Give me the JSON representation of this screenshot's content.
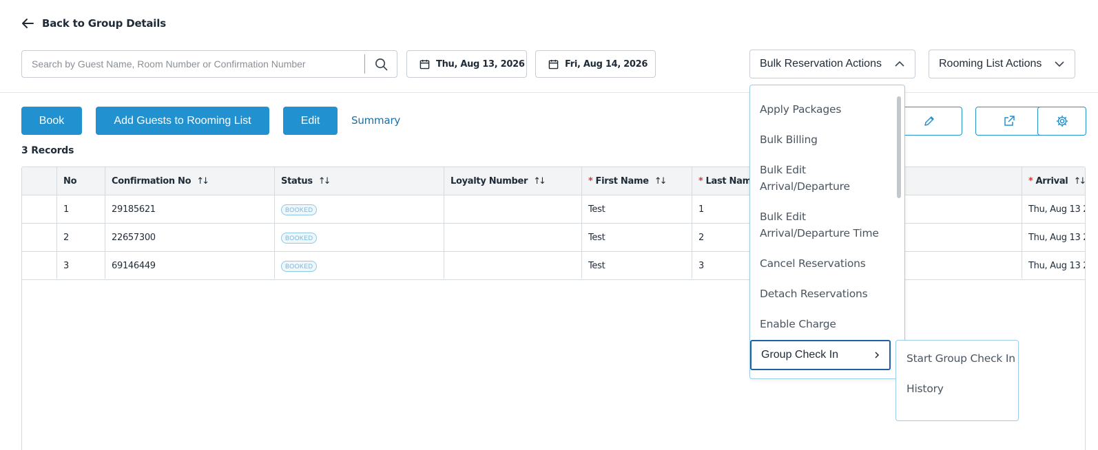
{
  "nav": {
    "back_label": "Back to Group Details"
  },
  "search": {
    "placeholder": "Search by Guest Name, Room Number or Confirmation Number",
    "value": ""
  },
  "dates": {
    "arrival": "Thu, Aug 13, 2026",
    "departure": "Fri, Aug 14, 2026"
  },
  "dropdowns": {
    "bulk_actions": "Bulk Reservation Actions",
    "rooming_actions": "Rooming List Actions"
  },
  "toolbar": {
    "book": "Book",
    "add_guests": "Add Guests to Rooming List",
    "edit": "Edit",
    "summary": "Summary"
  },
  "records_label": "3 Records",
  "table": {
    "headers": {
      "no": "No",
      "confirmation": "Confirmation No",
      "status": "Status",
      "loyalty": "Loyalty Number",
      "first_name": "First Name",
      "last_name": "Last Name",
      "arrival": "Arrival"
    },
    "required_mark": "*",
    "sort_icon": "sort-arrows-icon",
    "rows": [
      {
        "no": "1",
        "confirmation": "29185621",
        "status": "BOOKED",
        "loyalty": "",
        "first_name": "Test",
        "last_name": "1",
        "arrival": "Thu, Aug 13 2"
      },
      {
        "no": "2",
        "confirmation": "22657300",
        "status": "BOOKED",
        "loyalty": "",
        "first_name": "Test",
        "last_name": "2",
        "arrival": "Thu, Aug 13 2"
      },
      {
        "no": "3",
        "confirmation": "69146449",
        "status": "BOOKED",
        "loyalty": "",
        "first_name": "Test",
        "last_name": "3",
        "arrival": "Thu, Aug 13 2"
      }
    ]
  },
  "bulk_menu": {
    "items": [
      "Apply Packages",
      "Bulk Billing",
      "Bulk Edit Arrival/Departure",
      "Bulk Edit Arrival/Departure Time",
      "Cancel Reservations",
      "Detach Reservations",
      "Enable Charge",
      "Group Check In"
    ],
    "submenu": [
      "Start Group Check In",
      "History"
    ]
  },
  "colors": {
    "primary": "#2291cf",
    "link": "#1a6fa6",
    "focus": "#1f5fa6",
    "required": "#d83a3a"
  }
}
